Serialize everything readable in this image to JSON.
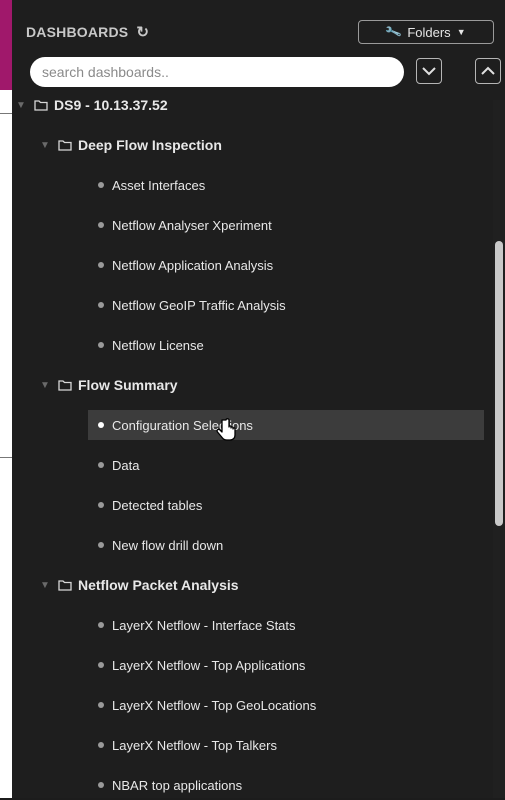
{
  "header": {
    "title": "DASHBOARDS",
    "refresh_icon": "refresh-icon"
  },
  "folders_button": {
    "label": "Folders",
    "icon": "wrench-icon"
  },
  "search": {
    "placeholder": "search dashboards..",
    "value": ""
  },
  "tree": {
    "root": {
      "label": "DS9 - 10.13.37.52"
    },
    "groups": [
      {
        "label": "Deep Flow Inspection",
        "items": [
          "Asset Interfaces",
          "Netflow Analyser Xperiment",
          "Netflow Application Analysis",
          "Netflow GeoIP Traffic Analysis",
          "Netflow License"
        ]
      },
      {
        "label": "Flow Summary",
        "items": [
          "Configuration Selections",
          "Data",
          "Detected tables",
          "New flow drill down"
        ]
      },
      {
        "label": "Netflow Packet Analysis",
        "items": [
          "LayerX Netflow - Interface Stats",
          "LayerX Netflow - Top Applications",
          "LayerX Netflow - Top GeoLocations",
          "LayerX Netflow - Top Talkers",
          "NBAR top applications"
        ]
      }
    ],
    "selected": "Configuration Selections"
  },
  "colors": {
    "panel_bg": "#1e1e1e",
    "selected_bg": "#3c3c3c",
    "accent": "#a0186b",
    "text": "#e8e8e8"
  }
}
